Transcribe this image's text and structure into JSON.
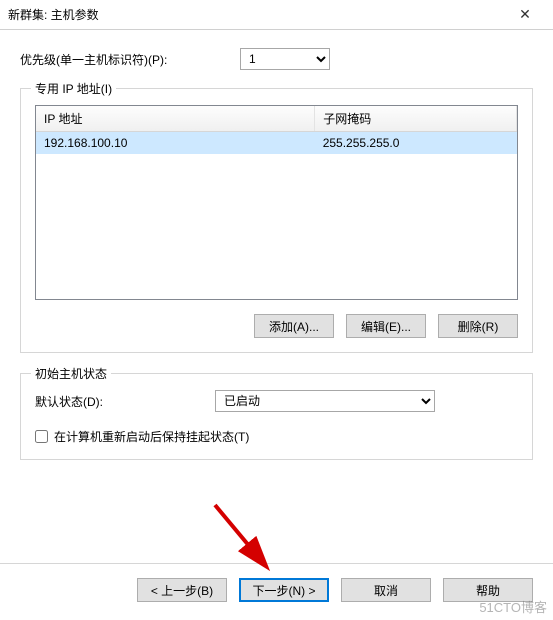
{
  "titlebar": {
    "title": "新群集: 主机参数"
  },
  "priority": {
    "label": "优先级(单一主机标识符)(P):",
    "value": "1"
  },
  "ip_group": {
    "legend": "专用 IP 地址(I)",
    "col_ip": "IP 地址",
    "col_mask": "子网掩码",
    "rows": [
      {
        "ip": "192.168.100.10",
        "mask": "255.255.255.0"
      }
    ],
    "add_label": "添加(A)...",
    "edit_label": "编辑(E)...",
    "remove_label": "删除(R)"
  },
  "state_group": {
    "legend": "初始主机状态",
    "default_label": "默认状态(D):",
    "default_value": "已启动",
    "checkbox_label": "在计算机重新启动后保持挂起状态(T)"
  },
  "footer": {
    "back": "< 上一步(B)",
    "next": "下一步(N) >",
    "cancel": "取消",
    "help": "帮助"
  },
  "watermark": "51CTO博客"
}
